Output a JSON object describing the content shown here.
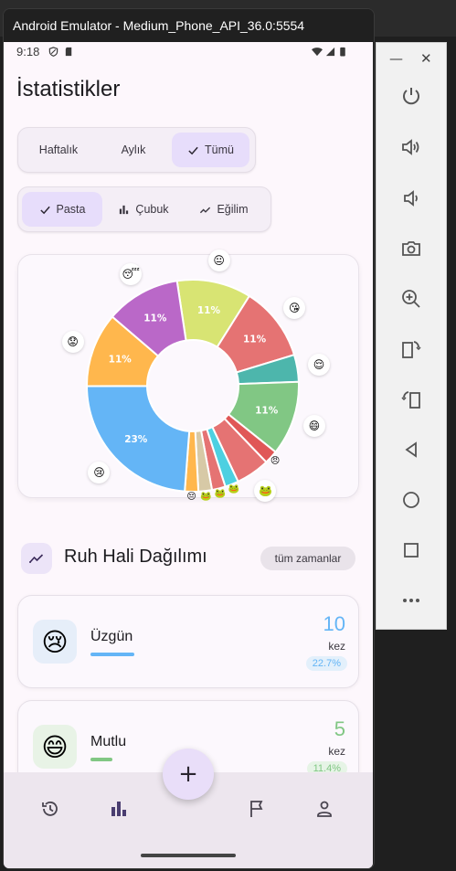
{
  "window": {
    "title": "Android Emulator - Medium_Phone_API_36.0:5554"
  },
  "status_bar": {
    "time": "9:18"
  },
  "page": {
    "title": "İstatistikler"
  },
  "period_tabs": [
    {
      "label": "Haftalık",
      "active": false
    },
    {
      "label": "Aylık",
      "active": false
    },
    {
      "label": "Tümü",
      "active": true
    }
  ],
  "chart_tabs": [
    {
      "label": "Pasta",
      "active": true,
      "icon": "check-icon"
    },
    {
      "label": "Çubuk",
      "active": false,
      "icon": "bar-chart-icon"
    },
    {
      "label": "Eğilim",
      "active": false,
      "icon": "trend-icon"
    }
  ],
  "chart_data": {
    "type": "pie",
    "donut": true,
    "slices": [
      {
        "label": "😐",
        "percent": 11,
        "value_label": "11%",
        "color": "#d8e473"
      },
      {
        "label": "😘",
        "percent": 11,
        "value_label": "11%",
        "color": "#e57373"
      },
      {
        "label": "😌",
        "percent": 4,
        "value_label": "",
        "color": "#4db6ac"
      },
      {
        "label": "😄",
        "percent": 11,
        "value_label": "11%",
        "color": "#81c784"
      },
      {
        "label": "😠",
        "percent": 2,
        "value_label": "",
        "color": "#e05757"
      },
      {
        "label": "🐸",
        "percent": 5,
        "value_label": "",
        "color": "#e57373"
      },
      {
        "label": "🐸",
        "percent": 2,
        "value_label": "",
        "color": "#4dd0e1"
      },
      {
        "label": "🐸",
        "percent": 2,
        "value_label": "",
        "color": "#e57373"
      },
      {
        "label": "🐸",
        "percent": 2,
        "value_label": "",
        "color": "#d7c9a6"
      },
      {
        "label": "😔",
        "percent": 2,
        "value_label": "",
        "color": "#ffb74d"
      },
      {
        "label": "😢",
        "percent": 23,
        "value_label": "23%",
        "color": "#64b5f6"
      },
      {
        "label": "😟",
        "percent": 11,
        "value_label": "11%",
        "color": "#ffb74d"
      },
      {
        "label": "😴",
        "percent": 11,
        "value_label": "11%",
        "color": "#ba68c8"
      }
    ]
  },
  "section": {
    "title": "Ruh Hali Dağılımı",
    "filter_chip": "tüm zamanlar"
  },
  "moods": [
    {
      "emoji": "😢",
      "name": "Üzgün",
      "count": "10",
      "unit": "kez",
      "percent": "22.7%",
      "color": "#64b5f6",
      "bg": "#e6eef9",
      "pct_bg": "#e3f0fb",
      "bar_fraction": 0.227
    },
    {
      "emoji": "😄",
      "name": "Mutlu",
      "count": "5",
      "unit": "kez",
      "percent": "11.4%",
      "color": "#81c784",
      "bg": "#e8f3e6",
      "pct_bg": "#e6f4e6",
      "bar_fraction": 0.114
    }
  ],
  "fab": {
    "label": "+"
  },
  "nav": [
    {
      "icon": "history-icon"
    },
    {
      "icon": "bar-chart-icon"
    },
    {
      "icon": "flag-icon"
    },
    {
      "icon": "person-icon"
    }
  ],
  "toolbar": {
    "buttons": [
      "power-icon",
      "volume-up-icon",
      "volume-down-icon",
      "camera-icon",
      "zoom-in-icon",
      "rotate-left-icon",
      "rotate-right-icon",
      "back-icon",
      "home-icon",
      "overview-icon",
      "more-icon"
    ]
  }
}
